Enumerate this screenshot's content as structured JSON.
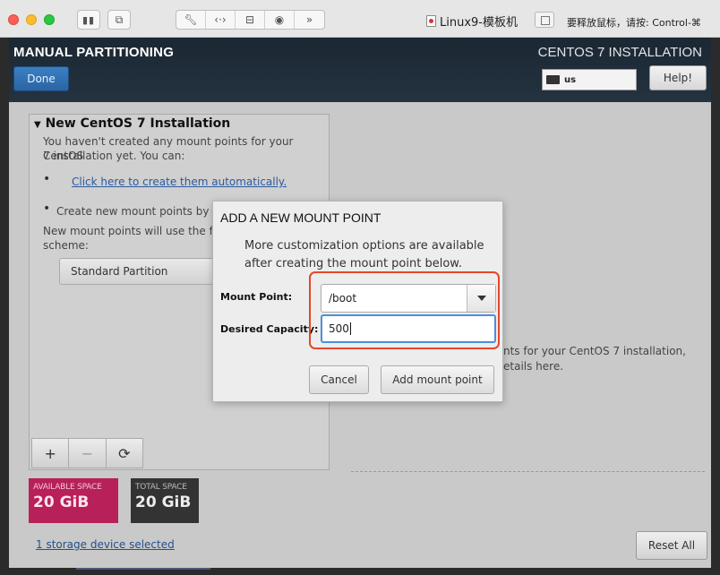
{
  "titlebar": {
    "vm_name": "Linux9-模板机",
    "release_hint": "要释放鼠标，请按: Control-⌘",
    "toolbar_icons": [
      "pause-icon",
      "snapshot-icon",
      "settings-icon",
      "code-icon",
      "drive-icon",
      "user-icon",
      "forward-icon"
    ]
  },
  "header": {
    "title": "MANUAL PARTITIONING",
    "done_label": "Done",
    "product": "CENTOS 7 INSTALLATION",
    "keyboard_layout": "us",
    "help_label": "Help!"
  },
  "left_panel": {
    "title": "New CentOS 7 Installation",
    "intro_line1": "You haven't created any mount points for your CentOS",
    "intro_line2": "7 installation yet.  You can:",
    "auto_link": "Click here to create them automatically.",
    "manual_text": "Create new mount points by cl",
    "scheme_line1": "New mount points will use the fo",
    "scheme_line2": "scheme:",
    "scheme_value": "Standard Partition",
    "tool_add": "+",
    "tool_remove": "−",
    "tool_refresh": "⟳"
  },
  "space": {
    "available_label": "AVAILABLE SPACE",
    "available_value": "20 GiB",
    "total_label": "TOTAL SPACE",
    "total_value": "20 GiB"
  },
  "right_text": {
    "line1": "nts for your CentOS 7 installation,",
    "line2": "etails here."
  },
  "storage_link": "1 storage device selected",
  "reset_label": "Reset All",
  "dialog": {
    "title": "ADD A NEW MOUNT POINT",
    "desc_line1": "More customization options are available",
    "desc_line2": "after creating the mount point below.",
    "mount_point_label": "Mount Point:",
    "mount_point_value": "/boot",
    "capacity_label": "Desired Capacity:",
    "capacity_value": "500",
    "cancel_label": "Cancel",
    "add_label": "Add mount point",
    "highlight_color": "#e5472a"
  }
}
